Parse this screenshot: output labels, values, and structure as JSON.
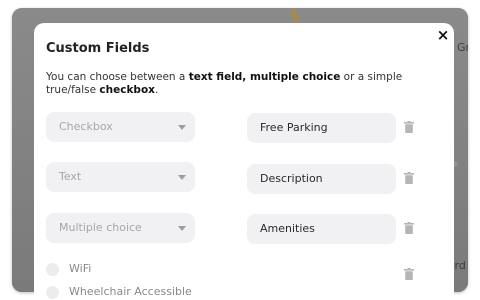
{
  "background_map": {
    "labels": [
      "Gr",
      "utsaard"
    ]
  },
  "modal": {
    "title": "Custom Fields",
    "close_symbol": "×",
    "description": {
      "part1": "You can choose between a ",
      "bold1": "text field, multiple choice",
      "part2": " or a simple true/false ",
      "bold2": "checkbox",
      "part3": "."
    },
    "rows": [
      {
        "type": "Checkbox",
        "name": "Free Parking"
      },
      {
        "type": "Text",
        "name": "Description"
      },
      {
        "type": "Multiple choice",
        "name": "Amenities"
      }
    ],
    "options": [
      "WiFi",
      "Wheelchair Accessible"
    ]
  },
  "icons": {
    "close": "close-icon",
    "caret": "chevron-down-icon",
    "delete": "trash-icon"
  },
  "colors": {
    "input_bg": "#f1f1f3",
    "placeholder": "#a6a6ab",
    "trash": "#b5b5b5"
  }
}
